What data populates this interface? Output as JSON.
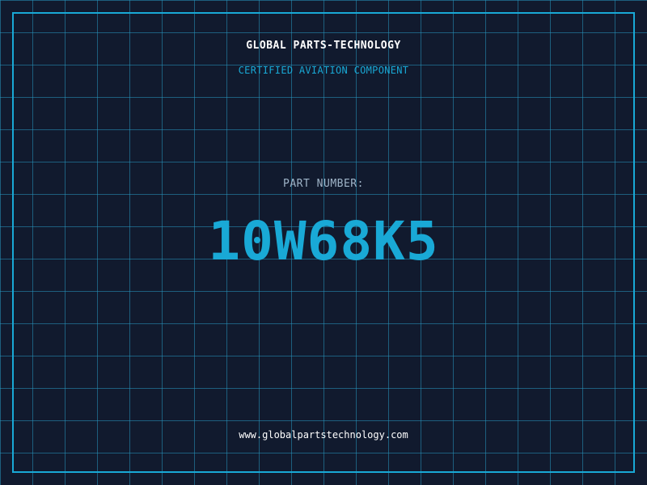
{
  "header": {
    "company": "GLOBAL PARTS-TECHNOLOGY",
    "subtitle": "CERTIFIED AVIATION COMPONENT"
  },
  "part": {
    "label": "PART NUMBER:",
    "number": "10W68K5"
  },
  "footer": {
    "website": "www.globalpartstechnology.com"
  },
  "colors": {
    "background": "#111a2e",
    "grid": "#2696be",
    "accent": "#19a9d6",
    "text": "#ffffff",
    "muted": "#9fb4c8"
  }
}
